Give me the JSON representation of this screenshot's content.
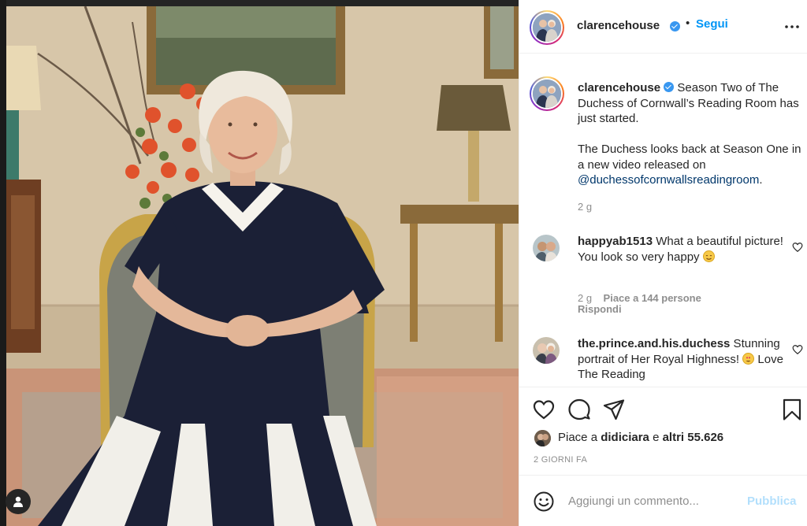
{
  "post": {
    "photo_alt": "",
    "colors": {
      "link": "#00376b",
      "follow": "#0095f6",
      "verified": "#3897f0",
      "publish_disabled": "#b2dffc",
      "muted": "#8e8e8e"
    }
  },
  "header": {
    "username": "clarencehouse",
    "separator": "•",
    "follow_label": "Segui",
    "more_icon": "more-horizontal-icon"
  },
  "caption": {
    "username": "clarencehouse",
    "text_line1": " Season Two of The Duchess of Cornwall’s Reading Room has just started.",
    "text_line2": "The Duchess looks back at Season One in a new video released on ",
    "mention": "@duchessofcornwallsreadingroom",
    "text_end": ".",
    "time": "2 g"
  },
  "comments": [
    {
      "username": "happyab1513",
      "text": " What a beautiful picture! You look so very happy ",
      "emoji": "blush-emoji",
      "time": "2 g",
      "likes": "Piace a 144 persone",
      "reply_label": "Rispondi"
    },
    {
      "username": "the.prince.and.his.duchess",
      "text_before": " Stunning portrait of Her Royal Highness! ",
      "emoji": "heart-eyes-emoji",
      "text_after": " Love The Reading"
    }
  ],
  "actions": {
    "like_icon": "heart-icon",
    "comment_icon": "comment-icon",
    "share_icon": "send-icon",
    "save_icon": "bookmark-icon"
  },
  "likes": {
    "prefix": "Piace a ",
    "user": "didiciara",
    "middle": " e ",
    "others": "altri 55.626"
  },
  "timestamp": "2 GIORNI FA",
  "add_comment": {
    "placeholder": "Aggiungi un commento...",
    "publish_label": "Pubblica"
  }
}
